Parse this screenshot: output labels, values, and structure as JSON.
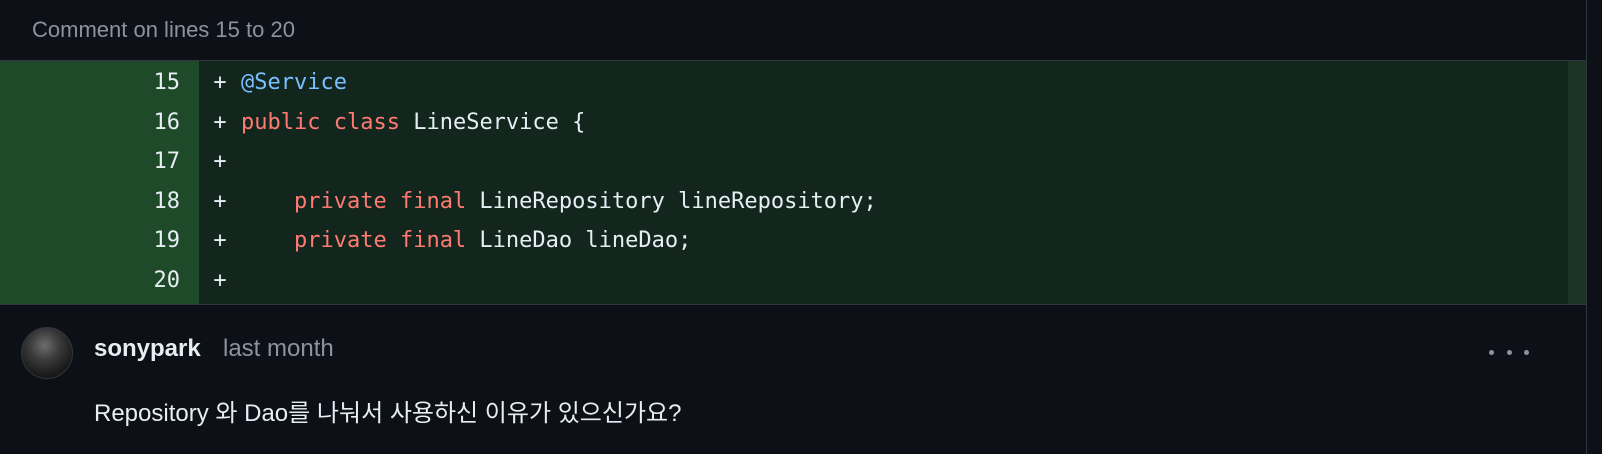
{
  "header": {
    "title": "Comment on lines 15 to 20"
  },
  "diff": {
    "lines": [
      {
        "number": "15",
        "marker": "+",
        "tokens": [
          {
            "t": "anno",
            "v": "@Service"
          }
        ]
      },
      {
        "number": "16",
        "marker": "+",
        "tokens": [
          {
            "t": "kw",
            "v": "public"
          },
          {
            "t": "plain",
            "v": " "
          },
          {
            "t": "kw",
            "v": "class"
          },
          {
            "t": "plain",
            "v": " LineService {"
          }
        ]
      },
      {
        "number": "17",
        "marker": "+",
        "tokens": []
      },
      {
        "number": "18",
        "marker": "+",
        "tokens": [
          {
            "t": "plain",
            "v": "    "
          },
          {
            "t": "kw",
            "v": "private"
          },
          {
            "t": "plain",
            "v": " "
          },
          {
            "t": "kw",
            "v": "final"
          },
          {
            "t": "plain",
            "v": " LineRepository lineRepository;"
          }
        ]
      },
      {
        "number": "19",
        "marker": "+",
        "tokens": [
          {
            "t": "plain",
            "v": "    "
          },
          {
            "t": "kw",
            "v": "private"
          },
          {
            "t": "plain",
            "v": " "
          },
          {
            "t": "kw",
            "v": "final"
          },
          {
            "t": "plain",
            "v": " LineDao lineDao;"
          }
        ]
      },
      {
        "number": "20",
        "marker": "+",
        "tokens": []
      }
    ]
  },
  "comment": {
    "author": "sonypark",
    "time": "last month",
    "body": "Repository 와 Dao를 나눠서 사용하신 이유가 있으신가요?"
  },
  "icons": {
    "more": "kebab-horizontal-icon",
    "avatar": "user-avatar"
  },
  "colors": {
    "background": "#0d1117",
    "added_line_bg": "#12261e",
    "added_gutter_bg": "#1f4a2a",
    "keyword": "#ff7b72",
    "annotation": "#79c0ff",
    "muted_text": "#8b949e"
  }
}
